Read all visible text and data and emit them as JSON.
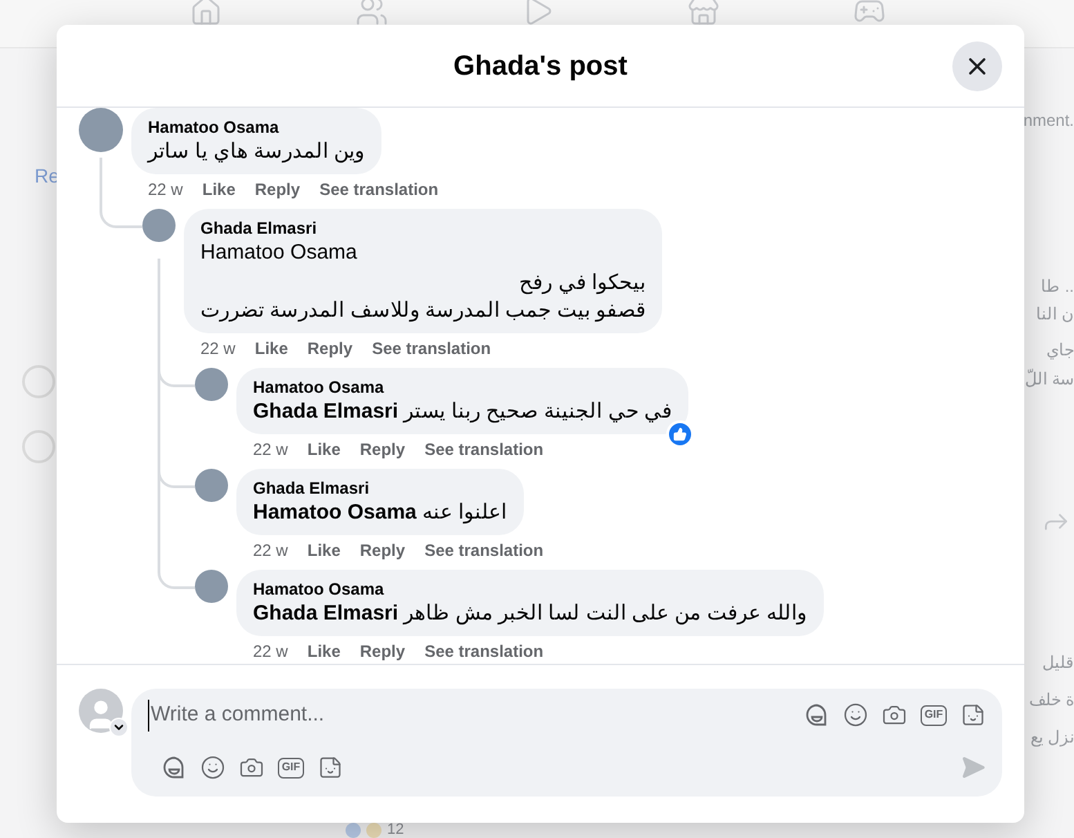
{
  "backdrop": {
    "left_text": "Re",
    "right_texts": [
      "nment.",
      ".. طا",
      "ن النا",
      "جاي",
      "سة اللّ",
      "قليل",
      "ة خلف",
      "نزل يع"
    ],
    "bottom_count": "12"
  },
  "dialog": {
    "title": "Ghada's post"
  },
  "comments": [
    {
      "author": "Hamatoo Osama",
      "lines": [
        "وين المدرسة هاي يا ساتر"
      ],
      "time": "22 w",
      "actions": [
        "Like",
        "Reply",
        "See translation"
      ],
      "liked": false,
      "children": [
        {
          "author": "Ghada Elmasri",
          "mention": "Hamatoo Osama",
          "lines": [
            "بيحكوا في رفح",
            "قصفو بيت جمب المدرسة وللاسف المدرسة تضررت"
          ],
          "time": "22 w",
          "actions": [
            "Like",
            "Reply",
            "See translation"
          ],
          "liked": false,
          "children": [
            {
              "author": "Hamatoo Osama",
              "lines": [
                "**Ghada Elmasri** في حي الجنينة صحيح ربنا يستر"
              ],
              "time": "22 w",
              "actions": [
                "Like",
                "Reply",
                "See translation"
              ],
              "liked": true
            },
            {
              "author": "Ghada Elmasri",
              "lines": [
                "**Hamatoo Osama** اعلنوا عنه"
              ],
              "time": "22 w",
              "actions": [
                "Like",
                "Reply",
                "See translation"
              ],
              "liked": false
            },
            {
              "author": "Hamatoo Osama",
              "lines": [
                "**Ghada Elmasri** والله عرفت من على النت لسا الخبر مش ظاهر"
              ],
              "time": "22 w",
              "actions": [
                "Like",
                "Reply",
                "See translation"
              ],
              "liked": false
            }
          ]
        }
      ]
    }
  ],
  "composer": {
    "placeholder": "Write a comment...",
    "toolbars": [
      {
        "gif_label": "GIF"
      },
      {
        "gif_label": "GIF"
      }
    ]
  }
}
